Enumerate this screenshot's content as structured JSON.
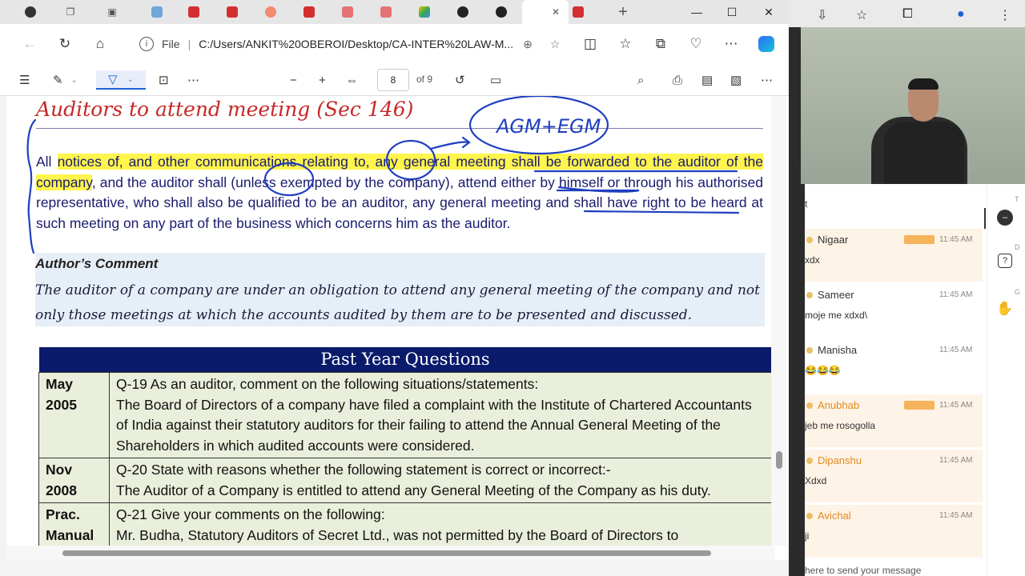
{
  "browser": {
    "tabs": [
      "profile",
      "copilot",
      "window",
      "tab",
      "pdf",
      "pdf",
      "record",
      "pdf",
      "pdf",
      "pdf",
      "drive",
      "github",
      "github",
      "active",
      "pdf"
    ],
    "new_tab": "+",
    "address": {
      "scheme_label": "File",
      "url": "C:/Users/ANKIT%20OBEROI/Desktop/CA-INTER%20LAW-M..."
    }
  },
  "pdf_toolbar": {
    "page_current": "8",
    "page_total": "of 9"
  },
  "document": {
    "heading": "Auditors to attend meeting (Sec 146)",
    "para_parts": [
      "All ",
      "notices of, and other communications relating to, any general meeting shall be forwarded to the auditor of the company",
      ", and the auditor shall (unless exempted by the company), attend either by himself or through his authorised representative, who shall also be qualified to be an auditor, any general meeting and shall have right to be heard at such meeting on any part of the business which concerns him as the auditor."
    ],
    "ink_note": "AGM+EGM",
    "comment_title": "Author’s Comment",
    "comment_text": "The auditor of a company are under an obligation to attend any general meeting of the company and not only those meetings at which the accounts audited by them are to be presented and discussed.",
    "pyq_title": "Past Year Questions",
    "pyq_rows": [
      {
        "year": "May 2005",
        "question": "Q-19 As an auditor, comment on the following situations/statements:",
        "detail": "The Board of Directors of a company have filed a complaint with the Institute of Chartered Accountants of India against their statutory auditors for their failing to attend the Annual General Meeting of the Shareholders in which audited accounts were considered."
      },
      {
        "year": "Nov 2008",
        "question": "Q-20 State with reasons whether the following statement is correct or incorrect:-",
        "detail": "The Auditor of a Company is entitled to attend any General Meeting of the Company as his duty."
      },
      {
        "year": "Prac. Manual",
        "question": "Q-21 Give your comments on the following:",
        "detail": "Mr. Budha, Statutory Auditors of Secret Ltd., was not permitted by the Board of Directors to"
      }
    ]
  },
  "chat": {
    "header_letter": "t",
    "messages": [
      {
        "name": "Nigaar",
        "time": "11:45 AM",
        "text": "xdx",
        "highlight": true,
        "badge": true
      },
      {
        "name": "Sameer",
        "time": "11:45 AM",
        "text": "moje me xdxd\\",
        "highlight": false,
        "badge": false
      },
      {
        "name": "Manisha",
        "time": "11:45 AM",
        "text": "😂😂😂",
        "highlight": false,
        "badge": false
      },
      {
        "name": "Anubhab",
        "time": "11:45 AM",
        "text": "jeb me rosogolla",
        "highlight": true,
        "badge": true
      },
      {
        "name": "Dipanshu",
        "time": "11:45 AM",
        "text": "Xdxd",
        "highlight": true,
        "badge": false
      },
      {
        "name": "Avichal",
        "time": "11:45 AM",
        "text": "ji",
        "highlight": true,
        "badge": false
      }
    ],
    "input_placeholder": "here to send your message",
    "tool_labels": [
      "T",
      "D",
      "G"
    ]
  },
  "colors": {
    "heading": "#c62828",
    "highlight": "#fff54d",
    "ink": "#1f3fbf",
    "pyq_header": "#0a1b6b",
    "pyq_cell": "#e9efda",
    "chat_name_highlight": "#e28b1e"
  }
}
